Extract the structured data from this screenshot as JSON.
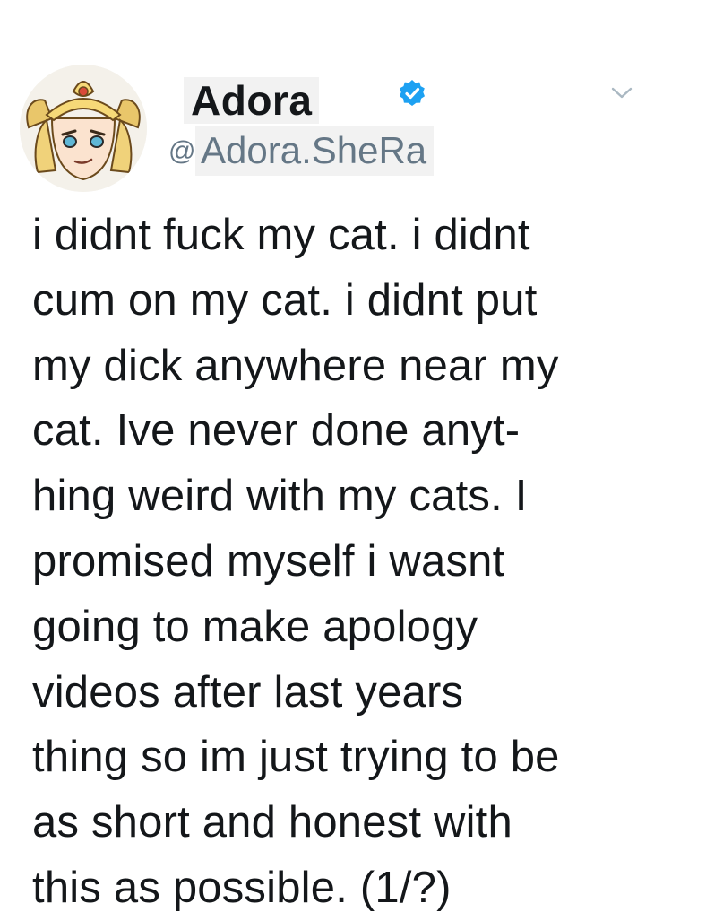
{
  "author": {
    "display_name": "Adora",
    "at_symbol": "@",
    "handle": "Adora.SheRa",
    "verified": true,
    "avatar_icon": "avatar-icon",
    "verified_icon": "verified-badge-icon"
  },
  "menu": {
    "icon": "chevron-down-icon"
  },
  "tweet": {
    "lines": [
      "i didnt fuck my cat. i didnt",
      "cum on my cat. i didnt put",
      "my dick anywhere near my",
      "cat. Ive never done anyt-",
      "hing weird with my cats. I",
      "promised myself i wasnt",
      "going to make apology",
      "videos after last years",
      "thing so im just trying to be",
      "as short and honest with",
      "this as possible. (1/?)"
    ]
  },
  "colors": {
    "verified_blue": "#1da1f2",
    "handle_gray": "#657786",
    "text": "#14171a",
    "chevron_gray": "#aab8c2"
  }
}
